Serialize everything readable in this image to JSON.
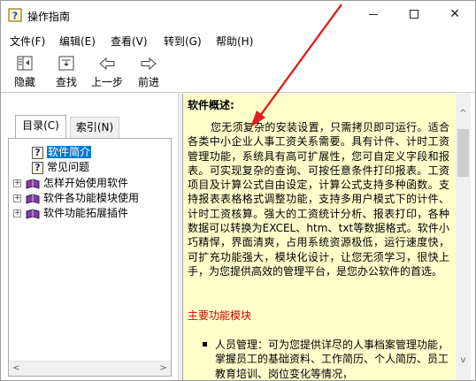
{
  "window": {
    "title": "操作指南"
  },
  "window_controls": {
    "close": "✕"
  },
  "menu": {
    "items": [
      "文件(F)",
      "编辑(E)",
      "查看(V)",
      "转到(G)",
      "帮助(H)"
    ]
  },
  "toolbar": {
    "buttons": [
      {
        "label": "隐藏",
        "icon": "hide-pane-icon"
      },
      {
        "label": "查找",
        "icon": "locate-icon"
      },
      {
        "label": "上一步",
        "icon": "back-arrow-icon"
      },
      {
        "label": "前进",
        "icon": "forward-arrow-icon"
      }
    ]
  },
  "nav": {
    "tabs": [
      {
        "label": "目录(C)",
        "active": true
      },
      {
        "label": "索引(N)",
        "active": false
      }
    ],
    "tree": [
      {
        "label": "软件简介",
        "type": "topic",
        "selected": true
      },
      {
        "label": "常见问题",
        "type": "topic",
        "selected": false
      },
      {
        "label": "怎样开始使用软件",
        "type": "book",
        "expander": "+"
      },
      {
        "label": "软件各功能模块使用",
        "type": "book",
        "expander": "+"
      },
      {
        "label": "软件功能拓展插件",
        "type": "book",
        "expander": "+"
      }
    ],
    "scroll_left": "<",
    "scroll_right": ">"
  },
  "content": {
    "title": "软件概述:",
    "paragraph": "您无须复杂的安装设置，只需拷贝即可运行。适合各类中小企业人事工资关系需要。具有计件、计时工资管理功能，系统具有高可扩展性，您可自定义字段和报表。可实现复杂的查询、可按任意条件打印报表。工资项目及计算公式自由设定，计算公式支持多种函数。支持报表表格格式调整功能，支持多用户模式下的计件、计时工资核算。强大的工资统计分析、报表打印，各种数据可以转换为EXCEL、htm、txt等数据格式。软件小巧精悍，界面清爽，占用系统资源极低，运行速度快，可扩充功能强大，模块化设计，让您无须学习，很快上手，为您提供高效的管理平台，是您办公软件的首选。",
    "section_heading": "主要功能模块",
    "bullets": [
      "人员管理：可为您提供详尽的人事档案管理功能，掌握员工的基础资料、工作简历、个人简历、员工教育培训、岗位变化等情况，"
    ],
    "scroll_up": "^",
    "scroll_down": "v"
  },
  "colors": {
    "content_bg": "#ffffcc",
    "selection": "#0078d7",
    "section_heading": "#d40000",
    "annotation_arrow": "#e02020"
  }
}
